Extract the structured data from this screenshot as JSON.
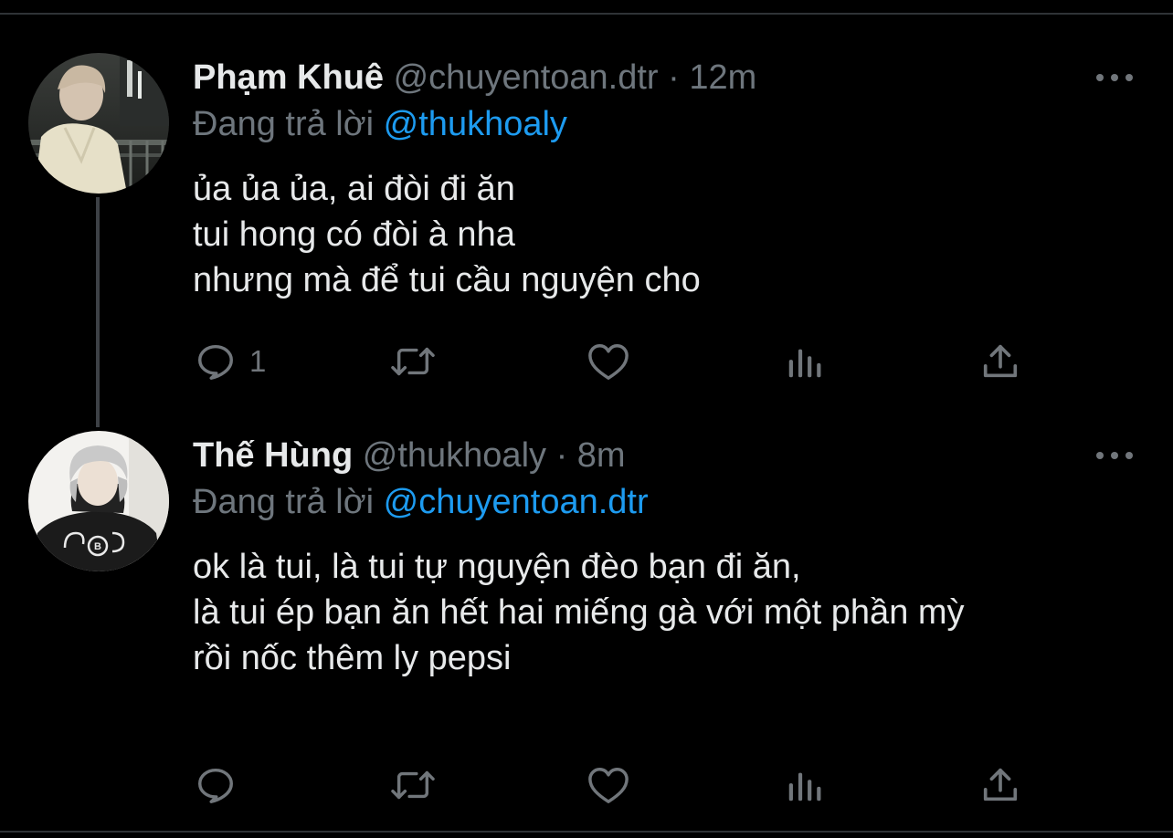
{
  "tweets": [
    {
      "name": "Phạm Khuê",
      "handle": "@chuyentoan.dtr",
      "separator": "·",
      "time": "12m",
      "reply_prefix": "Đang trả lời",
      "reply_to": "@thukhoaly",
      "lines": [
        "ủa ủa ủa, ai đòi đi ăn",
        "tui hong có đòi à nha",
        "nhưng mà để tui cầu nguyện cho"
      ],
      "reply_count": "1"
    },
    {
      "name": "Thế Hùng",
      "handle": "@thukhoaly",
      "separator": "·",
      "time": "8m",
      "reply_prefix": "Đang trả lời",
      "reply_to": "@chuyentoan.dtr",
      "lines": [
        "ok là tui, là tui tự nguyện đèo bạn đi ăn,",
        "là tui ép bạn ăn hết hai miếng gà với một phần mỳ",
        "rồi nốc thêm ly pepsi"
      ],
      "reply_count": ""
    }
  ],
  "icons": {
    "reply": "speech-bubble-icon",
    "retweet": "retweet-arrows-icon",
    "like": "heart-icon",
    "stats": "bar-chart-icon",
    "share": "share-upload-icon",
    "more": "ellipsis-icon"
  },
  "colors": {
    "background": "#000000",
    "text": "#e7e9ea",
    "muted": "#6e767d",
    "mention": "#1d9bf0",
    "thread_line": "#3d4146"
  }
}
